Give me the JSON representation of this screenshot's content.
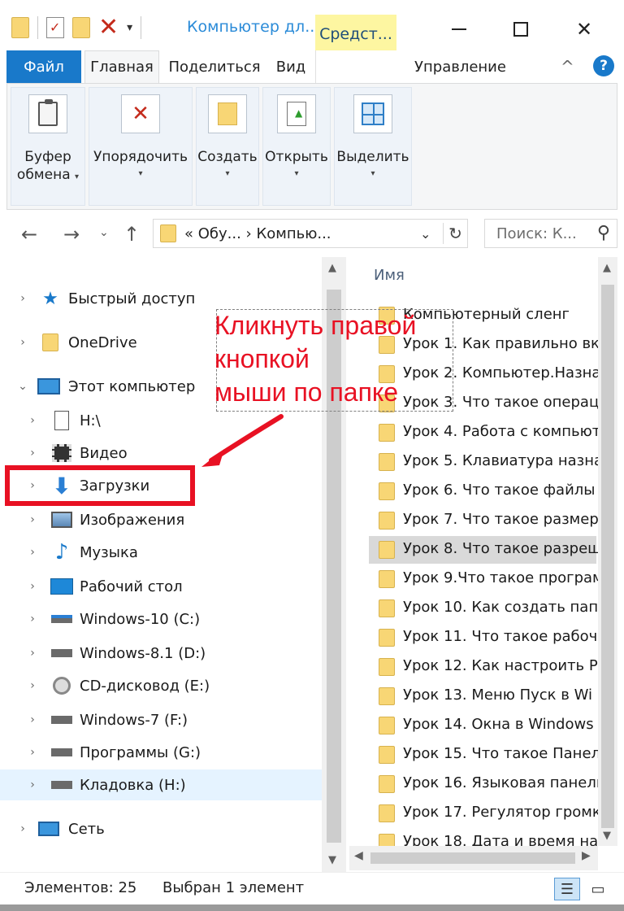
{
  "titlebar": {
    "title": "Компьютер дл...",
    "contextual_tab": "Средст...",
    "minimize_icon": "minimize-icon",
    "maximize_icon": "maximize-icon",
    "close_glyph": "✕"
  },
  "ribbon_tabs": {
    "file": "Файл",
    "home": "Главная",
    "share": "Поделиться",
    "view": "Вид",
    "manage": "Управление",
    "help": "?"
  },
  "ribbon": {
    "groups": [
      {
        "label_line1": "Буфер",
        "label_line2": "обмена",
        "icon": "clipboard-icon"
      },
      {
        "label_line1": "Упорядочить",
        "label_line2": "",
        "icon": "organize-icon"
      },
      {
        "label_line1": "Создать",
        "label_line2": "",
        "icon": "new-folder-icon"
      },
      {
        "label_line1": "Открыть",
        "label_line2": "",
        "icon": "open-icon"
      },
      {
        "label_line1": "Выделить",
        "label_line2": "",
        "icon": "select-icon"
      }
    ]
  },
  "address": {
    "path": "«  Обу...  ›  Компью...",
    "search_placeholder": "Поиск: К..."
  },
  "nav": {
    "items": [
      {
        "label": "Быстрый доступ",
        "icon": "star-icon"
      },
      {
        "label": "OneDrive",
        "icon": "folder-icon"
      },
      {
        "label": "Этот компьютер",
        "icon": "computer-icon"
      },
      {
        "label": "H:\\",
        "icon": "document-icon"
      },
      {
        "label": "Видео",
        "icon": "video-icon"
      },
      {
        "label": "Загрузки",
        "icon": "download-icon"
      },
      {
        "label": "Изображения",
        "icon": "image-icon"
      },
      {
        "label": "Музыка",
        "icon": "music-icon"
      },
      {
        "label": "Рабочий стол",
        "icon": "desktop-icon"
      },
      {
        "label": "Windows-10 (C:)",
        "icon": "drive-icon"
      },
      {
        "label": "Windows-8.1 (D:)",
        "icon": "drive-icon"
      },
      {
        "label": "CD-дисковод (E:)",
        "icon": "cd-drive-icon"
      },
      {
        "label": "Windows-7 (F:)",
        "icon": "drive-icon"
      },
      {
        "label": "Программы (G:)",
        "icon": "drive-icon"
      },
      {
        "label": "Кладовка (H:)",
        "icon": "drive-icon"
      },
      {
        "label": "Сеть",
        "icon": "network-icon"
      }
    ]
  },
  "content": {
    "column_name": "Имя",
    "files": [
      "Компьютерный сленг",
      "Урок 1. Как правильно вк",
      "Урок 2. Компьютер.Назна",
      "Урок 3. Что такое операц",
      "Урок 4. Работа с компьют",
      "Урок 5. Клавиатура назна",
      "Урок 6. Что такое файлы",
      "Урок 7. Что такое размер",
      "Урок 8. Что такое разреш",
      "Урок 9.Что такое програм",
      "Урок 10. Как создать папк",
      "Урок 11. Что такое рабоч",
      "Урок 12. Как настроить Ра",
      "Урок 13. Меню Пуск в Wi",
      "Урок 14. Окна в Windows",
      "Урок 15. Что такое Панел",
      "Урок 16. Языковая панель",
      "Урок 17. Регулятор громк",
      "Урок 18. Дата и время на"
    ],
    "selected_file": "Урок 8. Что такое разреш"
  },
  "annotation": {
    "text": "Кликнуть правой\nкнопкой\nмыши по папке",
    "color": "#e81123"
  },
  "status": {
    "count": "Элементов: 25",
    "selection": "Выбран 1 элемент"
  },
  "colors": {
    "accent": "#1979ca",
    "contextual": "#fdf6a1",
    "highlight": "#e81123"
  }
}
